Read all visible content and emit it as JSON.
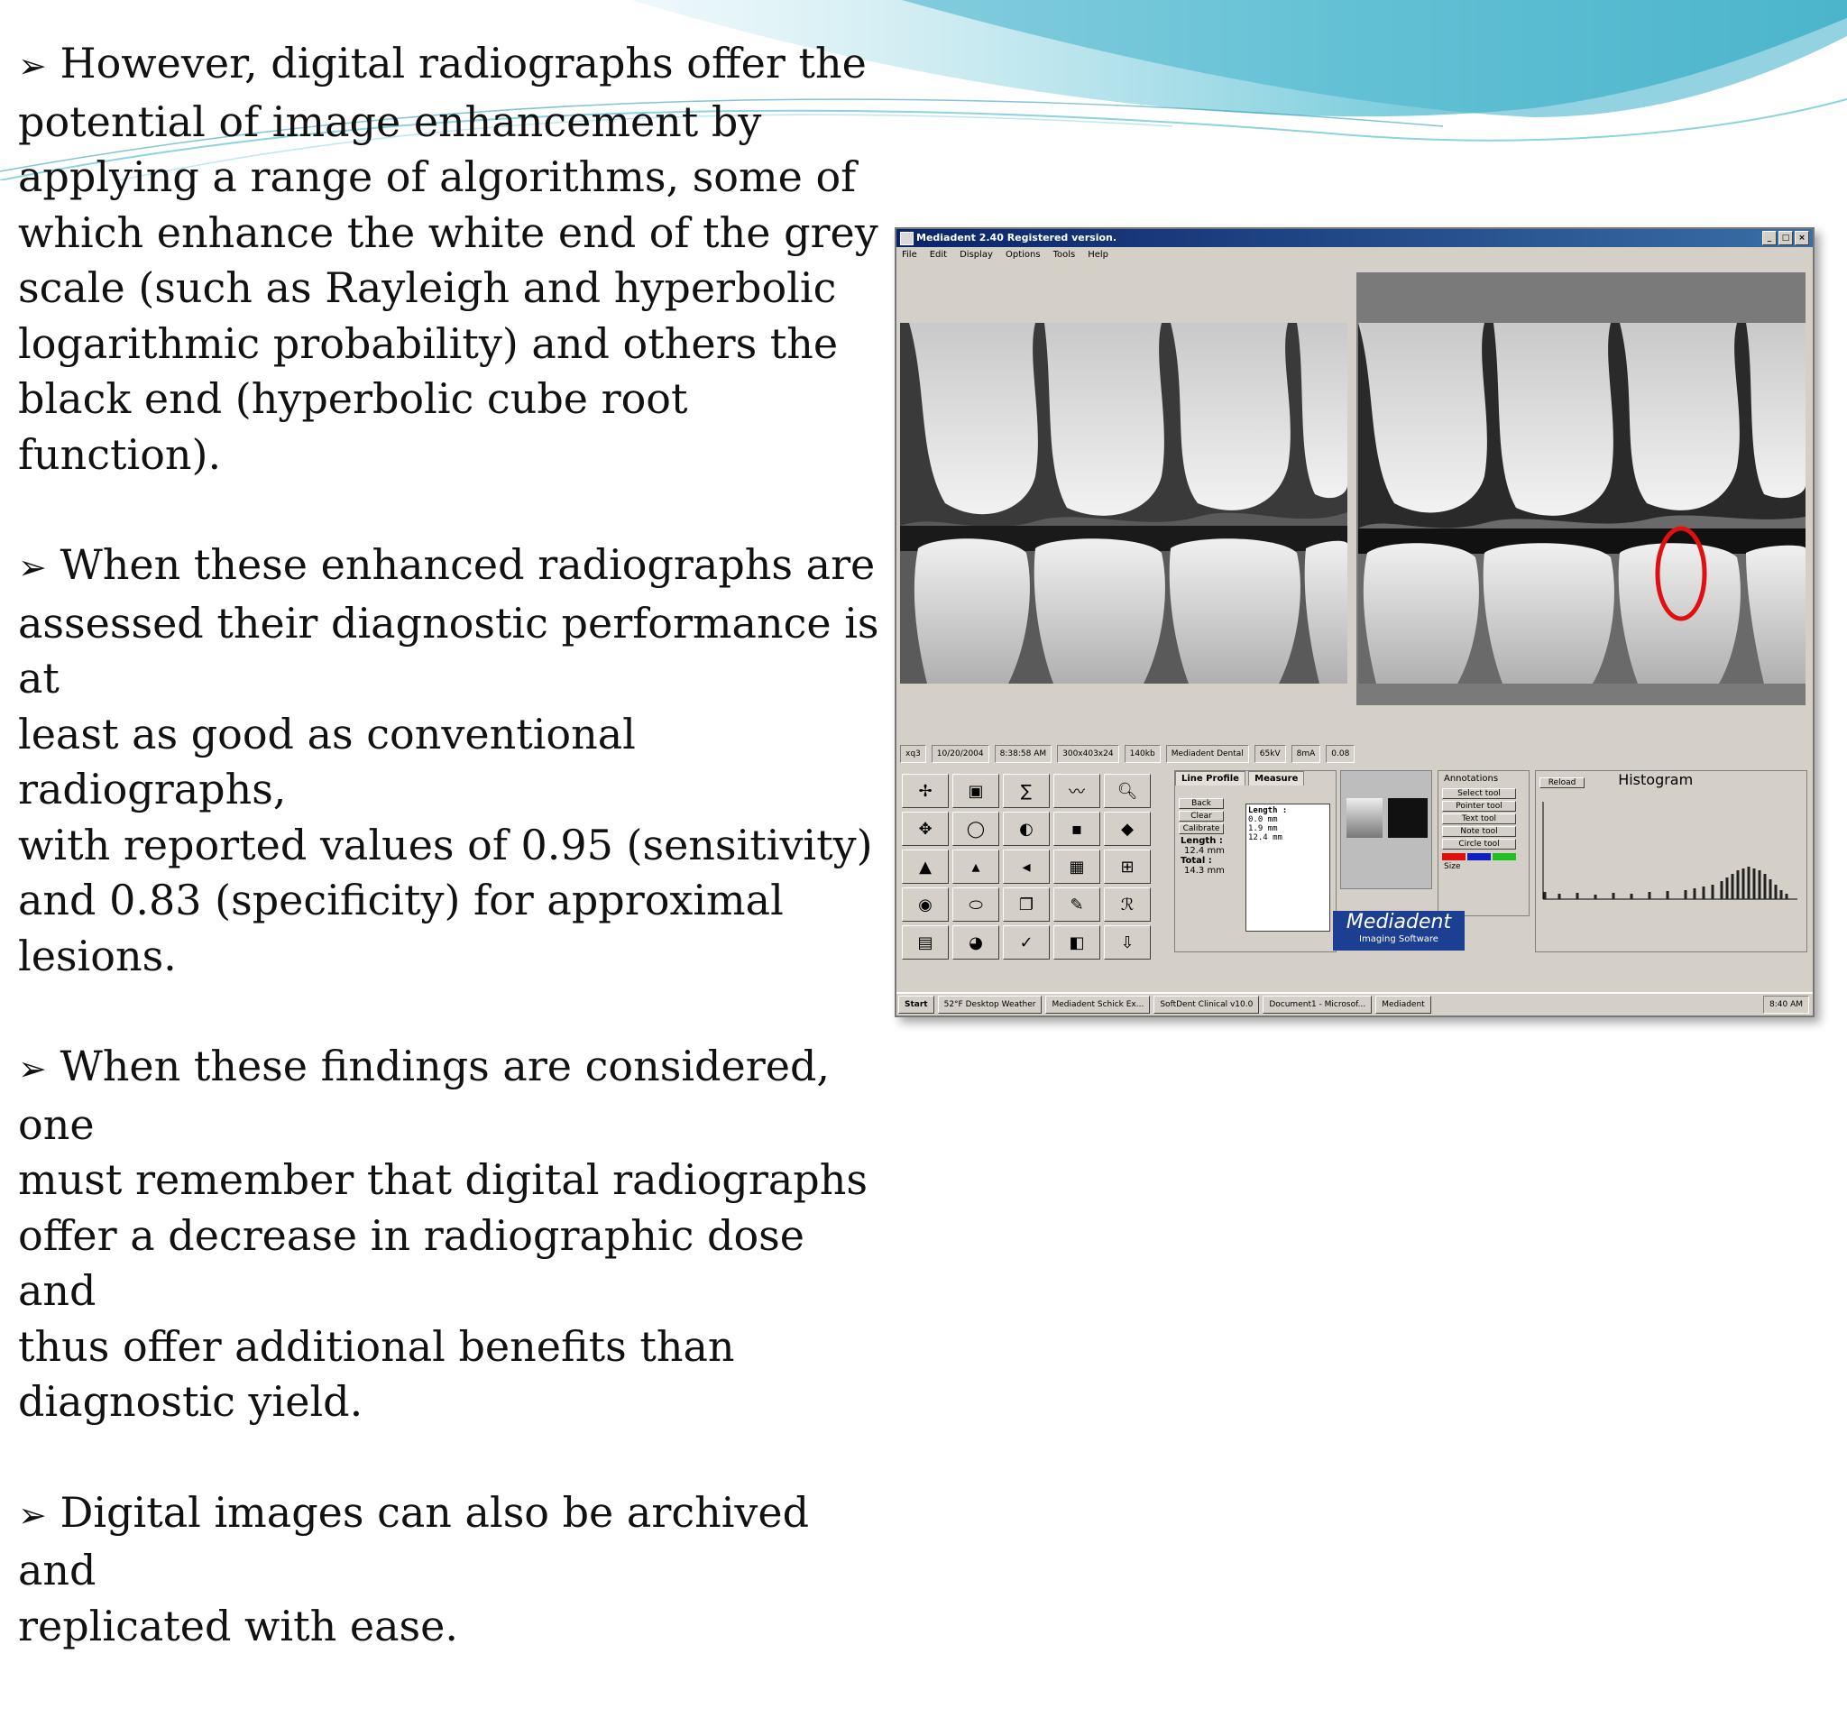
{
  "bullets": [
    {
      "marker": "➢",
      "text": "However, digital radiographs offer the\npotential of image enhancement by\napplying a range of algorithms, some of\nwhich enhance the white end of the grey\nscale (such as Rayleigh and hyperbolic\nlogarithmic probability) and others the\nblack end (hyperbolic cube root function)."
    },
    {
      "marker": "➢",
      "text": "When these enhanced radiographs are\nassessed their diagnostic performance is at\nleast as good as conventional radiographs,\nwith reported values of 0.95 (sensitivity)\nand 0.83 (specificity) for approximal\nlesions."
    },
    {
      "marker": "➢",
      "text": "When these findings are considered, one\nmust remember that digital radiographs\noffer a decrease in radiographic dose and\nthus offer additional benefits than\ndiagnostic yield."
    },
    {
      "marker": "➢",
      "text": "Digital images can also be archived and\nreplicated with ease."
    }
  ],
  "app": {
    "title": "Mediadent 2.40 Registered version.",
    "menu": [
      "File",
      "Edit",
      "Display",
      "Options",
      "Tools",
      "Help"
    ],
    "status": [
      "xq3",
      "10/20/2004",
      "8:38:58 AM",
      "300x403x24",
      "140kb",
      "Mediadent Dental",
      "65kV",
      "8mA",
      "0.08"
    ],
    "tabs": {
      "line_profile": "Line Profile",
      "measure": "Measure"
    },
    "measure_buttons": [
      "Back",
      "Clear",
      "Calibrate"
    ],
    "length_label": "Length :",
    "length_value": "12.4 mm",
    "total_label": "Total :",
    "total_value": "14.3 mm",
    "measurements": {
      "header": "Length :",
      "rows": [
        "0.0 mm",
        "1.9 mm",
        "12.4 mm"
      ]
    },
    "annotations": {
      "title": "Annotations",
      "tools": [
        "Select tool",
        "Pointer tool",
        "Text tool",
        "Note tool",
        "Circle tool"
      ],
      "size_label": "Size"
    },
    "histogram": {
      "title": "Histogram",
      "reload": "Reload"
    },
    "logo": {
      "name": "Mediadent",
      "tagline": "Imaging Software"
    },
    "taskbar": [
      "Start",
      "52°F Desktop Weather",
      "Mediadent Schick Ex...",
      "SoftDent Clinical v10.0",
      "Document1 - Microsof...",
      "Mediadent"
    ],
    "clock": "8:40 AM",
    "colors": {
      "titlebar": "#0a246a",
      "highlight_circle": "#e01010",
      "logo_bg": "#1d3f91"
    }
  }
}
